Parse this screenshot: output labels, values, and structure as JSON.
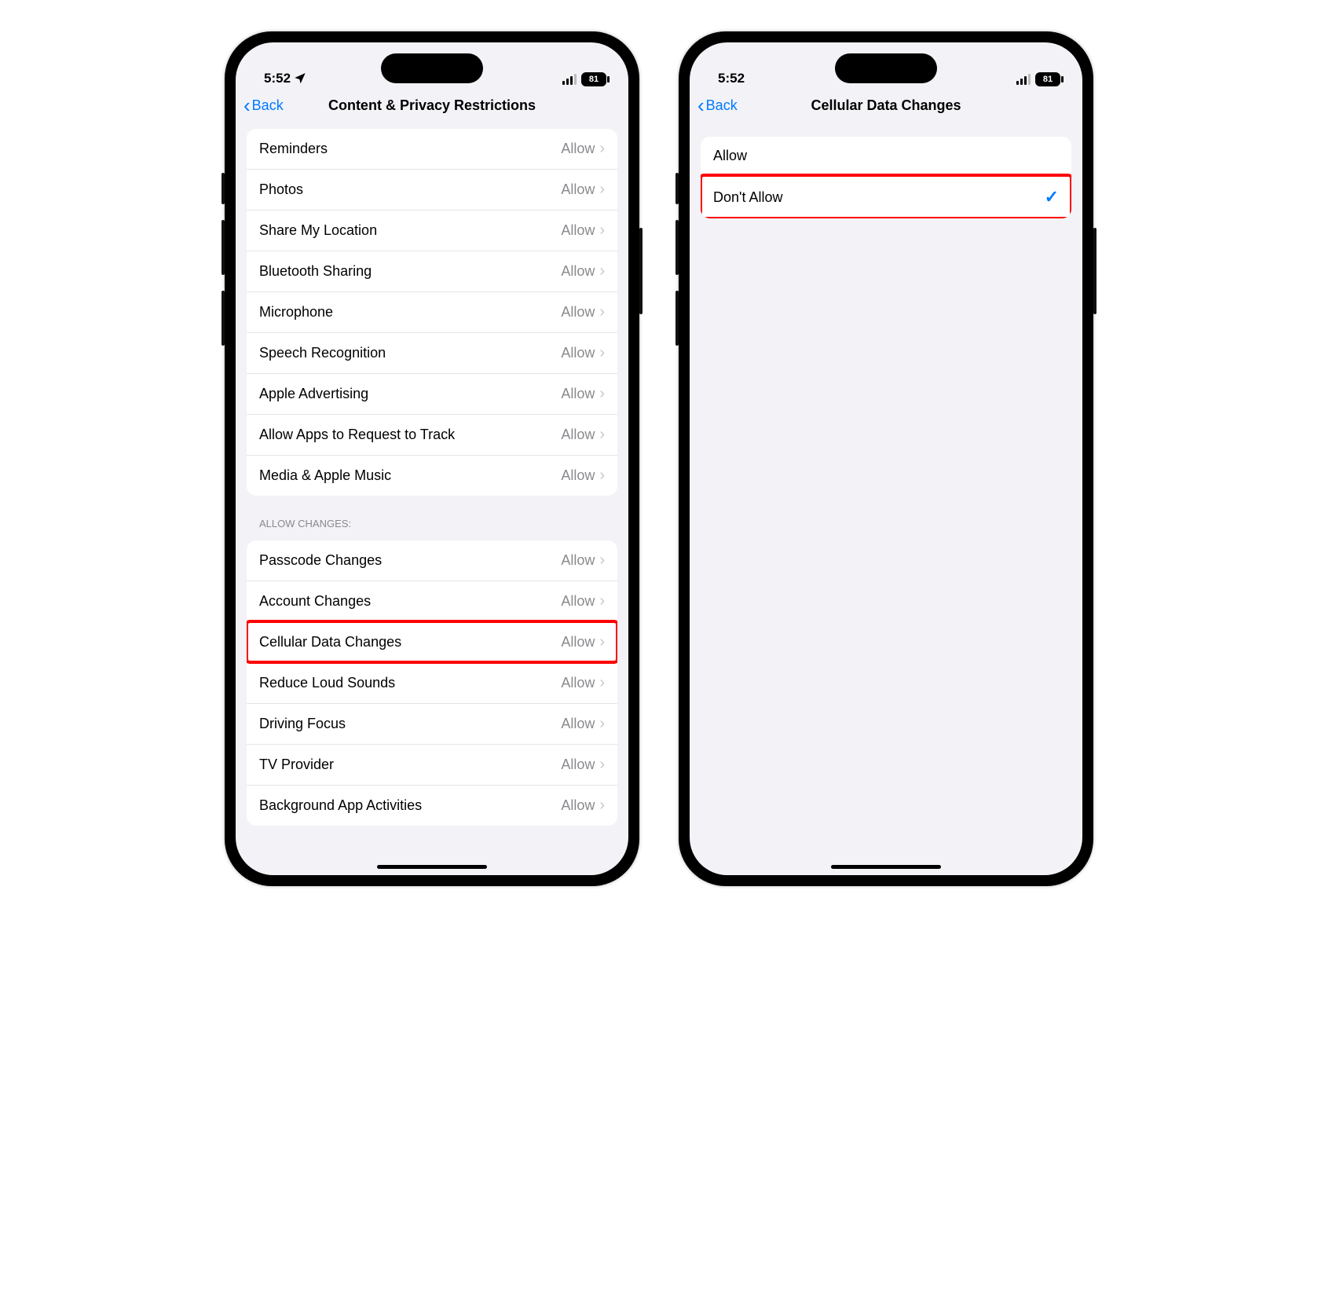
{
  "status": {
    "time": "5:52",
    "battery": "81"
  },
  "left": {
    "back_label": "Back",
    "title": "Content & Privacy Restrictions",
    "section1": [
      {
        "label": "Reminders",
        "value": "Allow"
      },
      {
        "label": "Photos",
        "value": "Allow"
      },
      {
        "label": "Share My Location",
        "value": "Allow"
      },
      {
        "label": "Bluetooth Sharing",
        "value": "Allow"
      },
      {
        "label": "Microphone",
        "value": "Allow"
      },
      {
        "label": "Speech Recognition",
        "value": "Allow"
      },
      {
        "label": "Apple Advertising",
        "value": "Allow"
      },
      {
        "label": "Allow Apps to Request to Track",
        "value": "Allow"
      },
      {
        "label": "Media & Apple Music",
        "value": "Allow"
      }
    ],
    "section2_header": "ALLOW CHANGES:",
    "section2": [
      {
        "label": "Passcode Changes",
        "value": "Allow"
      },
      {
        "label": "Account Changes",
        "value": "Allow"
      },
      {
        "label": "Cellular Data Changes",
        "value": "Allow",
        "highlight": true
      },
      {
        "label": "Reduce Loud Sounds",
        "value": "Allow"
      },
      {
        "label": "Driving Focus",
        "value": "Allow"
      },
      {
        "label": "TV Provider",
        "value": "Allow"
      },
      {
        "label": "Background App Activities",
        "value": "Allow"
      }
    ]
  },
  "right": {
    "back_label": "Back",
    "title": "Cellular Data Changes",
    "options": [
      {
        "label": "Allow",
        "selected": false
      },
      {
        "label": "Don't Allow",
        "selected": true,
        "highlight": true
      }
    ]
  }
}
